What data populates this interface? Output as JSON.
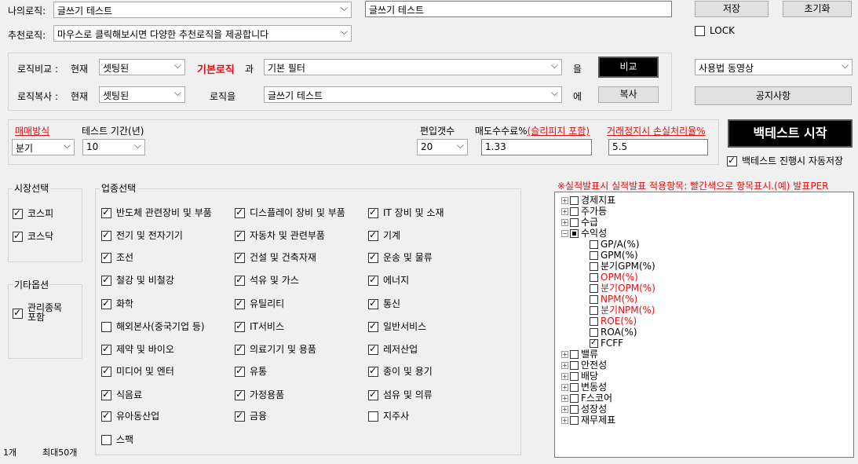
{
  "my_logic": {
    "label": "나의로직:",
    "value": "글쓰기 테스트",
    "name_value": "글쓰기 테스트"
  },
  "rec_logic": {
    "label": "추천로직:",
    "value": "마우스로 클릭해보시면 다양한 추천로직을 제공합니다"
  },
  "buttons": {
    "save": "저장",
    "reset": "초기화",
    "compare": "비교",
    "copy": "복사",
    "start": "백테스트 시작",
    "notice": "공지사항"
  },
  "lock_label": "LOCK",
  "compare": {
    "label": "로직비교 :",
    "current": "현재",
    "current_value": "셋팅된",
    "basic": "기본로직",
    "conj": "과",
    "target": "기본 필터",
    "suffix": "을"
  },
  "copy": {
    "label": "로직복사 :",
    "current": "현재",
    "current_value": "셋팅된",
    "logic_to": "로직을",
    "target": "글쓰기 테스트",
    "suffix": "에"
  },
  "tutorial": "사용법 동영상",
  "trade": {
    "method_label": "매매방식",
    "method_value": "분기",
    "period_label": "테스트 기간(년)",
    "period_value": "10",
    "count_label": "편입갯수",
    "count_value": "20",
    "fee_label": "매도수수료%",
    "fee_sub": "(슬리피지 포함)",
    "fee_value": "1.33",
    "stop_label": "거래정지시 손실처리율%",
    "stop_value": "5.5"
  },
  "autosave": "백테스트 진행시 자동저장",
  "market": {
    "title": "시장선택",
    "items": [
      {
        "label": "코스피",
        "checked": true
      },
      {
        "label": "코스닥",
        "checked": true
      }
    ]
  },
  "other": {
    "title": "기타옵션",
    "items": [
      {
        "label": "관리종목\n포함",
        "checked": true
      }
    ]
  },
  "sector": {
    "title": "업종선택",
    "cols": [
      [
        {
          "label": "반도체 관련장비 및 부품",
          "checked": true
        },
        {
          "label": "전기 및 전자기기",
          "checked": true
        },
        {
          "label": "조선",
          "checked": true
        },
        {
          "label": "철강 및 비철강",
          "checked": true
        },
        {
          "label": "화학",
          "checked": true
        },
        {
          "label": "해외본사(중국기업 등)",
          "checked": false
        },
        {
          "label": "제약 및 바이오",
          "checked": true
        },
        {
          "label": "미디어 및 엔터",
          "checked": true
        },
        {
          "label": "식음료",
          "checked": true
        },
        {
          "label": "유아동산업",
          "checked": true
        },
        {
          "label": "스팩",
          "checked": false
        }
      ],
      [
        {
          "label": "디스플레이 장비 및 부품",
          "checked": true
        },
        {
          "label": "자동차 및 관련부품",
          "checked": true
        },
        {
          "label": "건설 및 건축자재",
          "checked": true
        },
        {
          "label": "석유 및 가스",
          "checked": true
        },
        {
          "label": "유틸리티",
          "checked": true
        },
        {
          "label": "IT서비스",
          "checked": true
        },
        {
          "label": "의료기기 및 용품",
          "checked": true
        },
        {
          "label": "유통",
          "checked": true
        },
        {
          "label": "가정용품",
          "checked": true
        },
        {
          "label": "금융",
          "checked": true
        }
      ],
      [
        {
          "label": "IT 장비 및 소재",
          "checked": true
        },
        {
          "label": "기계",
          "checked": true
        },
        {
          "label": "운송 및 물류",
          "checked": true
        },
        {
          "label": "에너지",
          "checked": true
        },
        {
          "label": "통신",
          "checked": true
        },
        {
          "label": "일반서비스",
          "checked": true
        },
        {
          "label": "레저산업",
          "checked": true
        },
        {
          "label": "종이 및 용기",
          "checked": true
        },
        {
          "label": "섬유 및 의류",
          "checked": true
        },
        {
          "label": "지주사",
          "checked": false
        }
      ]
    ]
  },
  "footer": {
    "count": "1개",
    "max": "최대50개"
  },
  "notice_red": "※실적발표시 실적발표 적용항목: 빨간색으로 항목표시.(예) 발표PER",
  "tree": [
    {
      "label": "경제지표",
      "level": 0,
      "state": "off",
      "red": false
    },
    {
      "label": "주가등",
      "level": 0,
      "state": "off",
      "red": false
    },
    {
      "label": "수급",
      "level": 0,
      "state": "off",
      "red": false
    },
    {
      "label": "수익성",
      "level": 0,
      "state": "part",
      "red": false,
      "open": true
    },
    {
      "label": "GP/A(%)",
      "level": 1,
      "state": "off",
      "red": false
    },
    {
      "label": "GPM(%)",
      "level": 1,
      "state": "off",
      "red": false
    },
    {
      "label": "분기GPM(%)",
      "level": 1,
      "state": "off",
      "red": false
    },
    {
      "label": "OPM(%)",
      "level": 1,
      "state": "off",
      "red": true
    },
    {
      "label": "분기OPM(%)",
      "level": 1,
      "state": "off",
      "red": true
    },
    {
      "label": "NPM(%)",
      "level": 1,
      "state": "off",
      "red": true
    },
    {
      "label": "분기NPM(%)",
      "level": 1,
      "state": "off",
      "red": true
    },
    {
      "label": "ROE(%)",
      "level": 1,
      "state": "off",
      "red": true
    },
    {
      "label": "ROA(%)",
      "level": 1,
      "state": "off",
      "red": false
    },
    {
      "label": "FCFF",
      "level": 1,
      "state": "on",
      "red": false
    },
    {
      "label": "밸류",
      "level": 0,
      "state": "off",
      "red": false
    },
    {
      "label": "안전성",
      "level": 0,
      "state": "off",
      "red": false
    },
    {
      "label": "배당",
      "level": 0,
      "state": "off",
      "red": false
    },
    {
      "label": "변동성",
      "level": 0,
      "state": "off",
      "red": false
    },
    {
      "label": "F스코어",
      "level": 0,
      "state": "off",
      "red": false
    },
    {
      "label": "성장성",
      "level": 0,
      "state": "off",
      "red": false
    },
    {
      "label": "재무제표",
      "level": 0,
      "state": "off",
      "red": false
    }
  ]
}
